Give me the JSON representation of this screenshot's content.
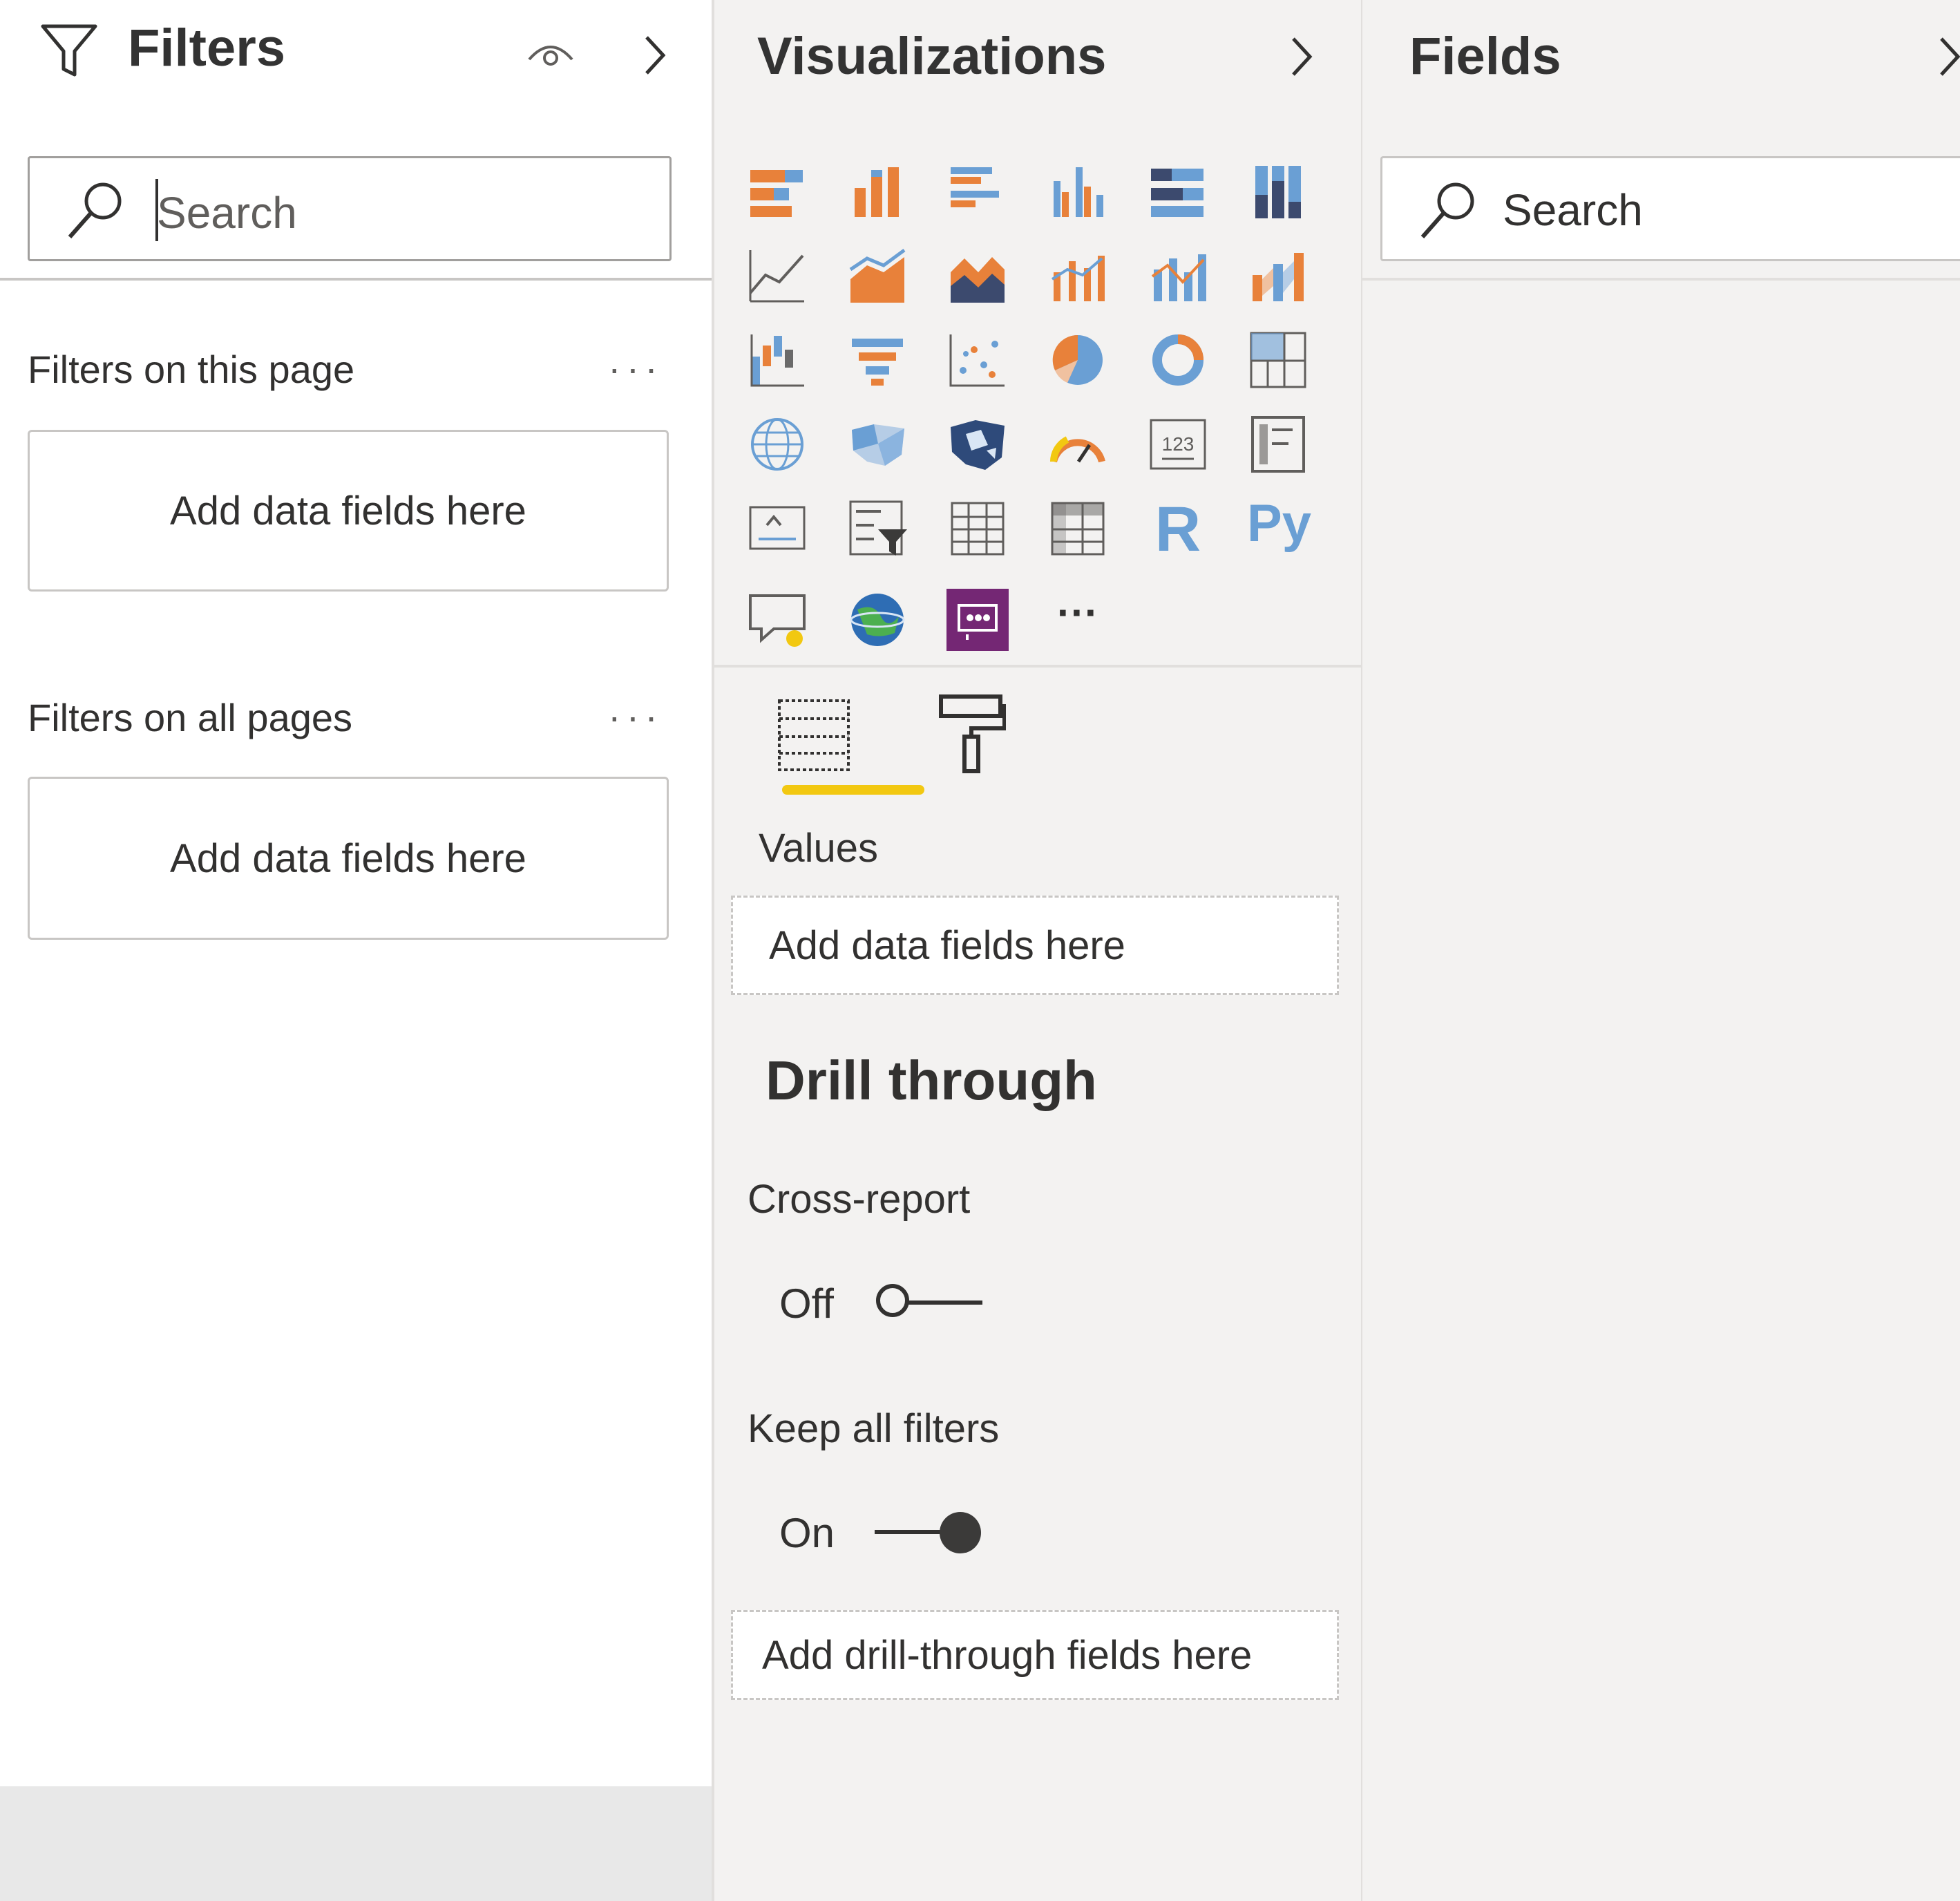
{
  "filters": {
    "title": "Filters",
    "search_placeholder": "Search",
    "page_section_label": "Filters on this page",
    "page_drop": "Add data fields here",
    "all_section_label": "Filters on all pages",
    "all_drop": "Add data fields here"
  },
  "visualizations": {
    "title": "Visualizations",
    "values_label": "Values",
    "values_drop": "Add data fields here",
    "drill_title": "Drill through",
    "cross_report_label": "Cross-report",
    "cross_report_state": "Off",
    "keep_filters_label": "Keep all filters",
    "keep_filters_state": "On",
    "drill_drop": "Add drill-through fields here",
    "active_tab": "fields",
    "icons": [
      "stacked-bar-icon",
      "stacked-column-icon",
      "clustered-bar-icon",
      "clustered-column-icon",
      "100-stacked-bar-icon",
      "100-stacked-column-icon",
      "line-chart-icon",
      "area-chart-icon",
      "stacked-area-icon",
      "line-clustered-column-icon",
      "line-stacked-column-icon",
      "ribbon-chart-icon",
      "waterfall-icon",
      "funnel-icon",
      "scatter-icon",
      "pie-chart-icon",
      "donut-chart-icon",
      "treemap-icon",
      "map-icon",
      "filled-map-icon",
      "shape-map-icon",
      "gauge-icon",
      "card-icon",
      "multi-row-card-icon",
      "kpi-icon",
      "slicer-icon",
      "table-icon",
      "matrix-icon",
      "r-visual-icon",
      "python-visual-icon",
      "qa-icon",
      "arcgis-map-icon",
      "custom-visual-icon",
      "more-visuals-icon"
    ],
    "r_glyph": "R",
    "py_glyph": "Py",
    "more_glyph": "···"
  },
  "fields": {
    "title": "Fields",
    "search_placeholder": "Search"
  },
  "colors": {
    "accent_yellow": "#f2c811",
    "chart_blue": "#6a9fd4",
    "chart_orange": "#e8813a",
    "custom_purple": "#742774"
  }
}
